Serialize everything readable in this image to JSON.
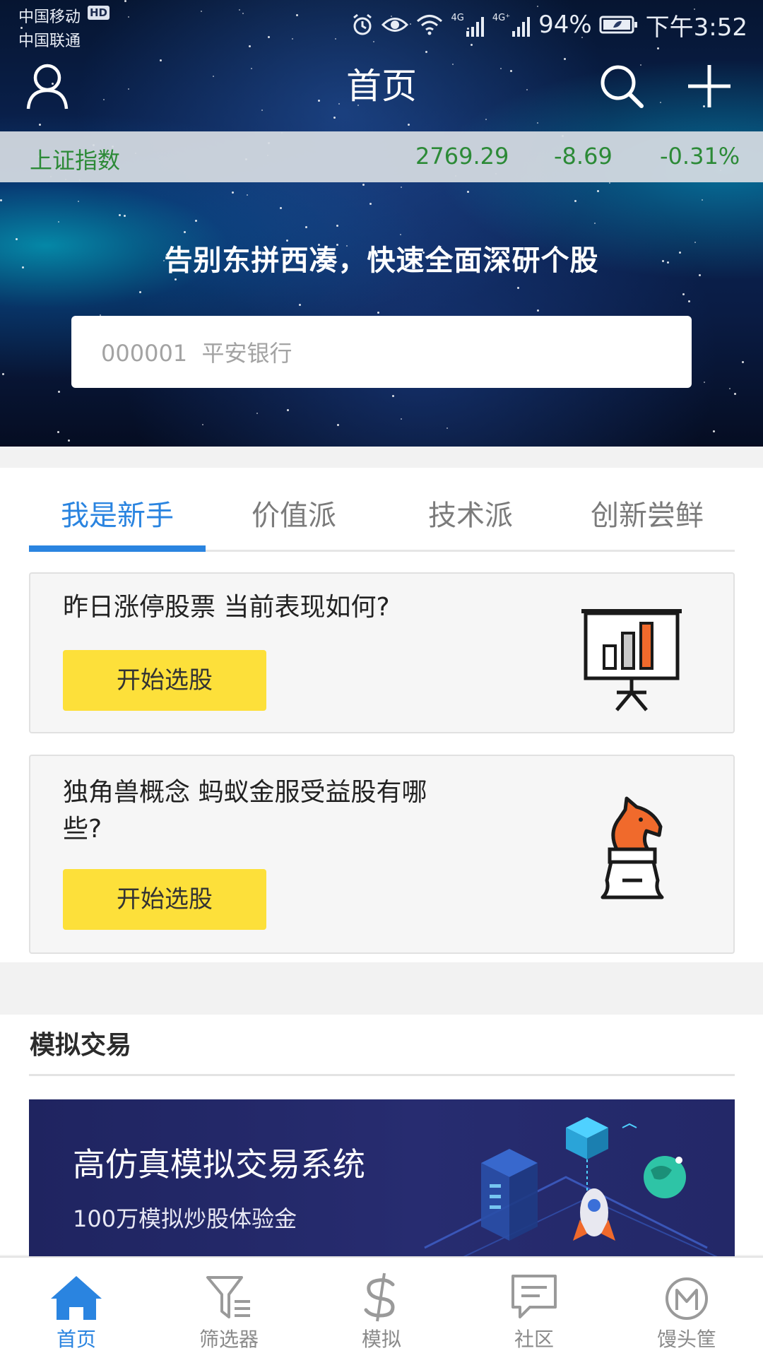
{
  "status_bar": {
    "carrier_1": "中国移动",
    "carrier_1_badge": "HD",
    "carrier_2": "中国联通",
    "network_1": "4G",
    "network_2": "4G⁺",
    "battery": "94%",
    "time": "下午3:52"
  },
  "nav": {
    "title": "首页"
  },
  "ticker": {
    "name": "上证指数",
    "price": "2769.29",
    "change": "-8.69",
    "change_pct": "-0.31%",
    "color": "#2c8a37"
  },
  "hero": {
    "slogan": "告别东拼西凑，快速全面深研个股",
    "search_placeholder": "000001  平安银行"
  },
  "tabs": [
    {
      "label": "我是新手",
      "active": true
    },
    {
      "label": "价值派",
      "active": false
    },
    {
      "label": "技术派",
      "active": false
    },
    {
      "label": "创新尝鲜",
      "active": false
    }
  ],
  "cards": [
    {
      "question": "昨日涨停股票 当前表现如何?",
      "button": "开始选股",
      "icon": "presentation-chart-icon"
    },
    {
      "question": "独角兽概念 蚂蚁金服受益股有哪些?",
      "button": "开始选股",
      "icon": "chess-knight-icon"
    }
  ],
  "simulated_trading": {
    "section_title": "模拟交易",
    "banner_title": "高仿真模拟交易系统",
    "banner_subtitle": "100万模拟炒股体验金"
  },
  "bottom_nav": [
    {
      "label": "首页",
      "icon": "home-icon",
      "active": true
    },
    {
      "label": "筛选器",
      "icon": "filter-icon",
      "active": false
    },
    {
      "label": "模拟",
      "icon": "dollar-icon",
      "active": false
    },
    {
      "label": "社区",
      "icon": "chat-icon",
      "active": false
    },
    {
      "label": "馒头筐",
      "icon": "m-logo-icon",
      "active": false
    }
  ],
  "colors": {
    "accent": "#2a84e0",
    "button_yellow": "#fde03a",
    "ticker_green": "#2c8a37"
  }
}
